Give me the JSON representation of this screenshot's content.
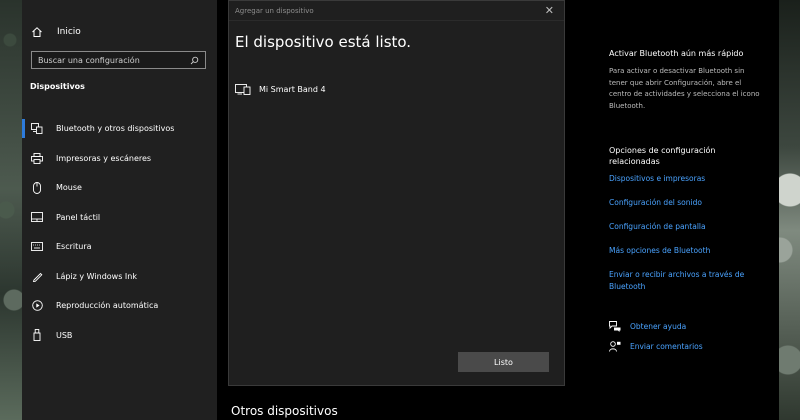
{
  "sidebar": {
    "home_label": "Inicio",
    "search_placeholder": "Buscar una configuración",
    "section_title": "Dispositivos",
    "items": [
      {
        "label": "Bluetooth y otros dispositivos",
        "icon": "bluetooth-devices-icon",
        "active": true
      },
      {
        "label": "Impresoras y escáneres",
        "icon": "printer-icon"
      },
      {
        "label": "Mouse",
        "icon": "mouse-icon"
      },
      {
        "label": "Panel táctil",
        "icon": "touchpad-icon"
      },
      {
        "label": "Escritura",
        "icon": "keyboard-icon"
      },
      {
        "label": "Lápiz y Windows Ink",
        "icon": "pen-icon"
      },
      {
        "label": "Reproducción automática",
        "icon": "autoplay-icon"
      },
      {
        "label": "USB",
        "icon": "usb-icon"
      }
    ]
  },
  "main": {
    "section_heading": "Otros dispositivos"
  },
  "dialog": {
    "title": "Agregar un dispositivo",
    "heading": "El dispositivo está listo.",
    "device_name": "Mi Smart Band 4",
    "done_label": "Listo"
  },
  "right_pane": {
    "bt_title": "Activar Bluetooth aún más rápido",
    "bt_desc": "Para activar o desactivar Bluetooth sin tener que abrir Configuración, abre el centro de actividades y selecciona el icono Bluetooth.",
    "related_title": "Opciones de configuración relacionadas",
    "links": [
      "Dispositivos e impresoras",
      "Configuración del sonido",
      "Configuración de pantalla",
      "Más opciones de Bluetooth",
      "Enviar o recibir archivos a través de Bluetooth"
    ],
    "help_label": "Obtener ayuda",
    "feedback_label": "Enviar comentarios"
  },
  "colors": {
    "accent": "#2d7bdc",
    "link": "#4aa3ff",
    "sidebar_bg": "#202020",
    "dialog_bg": "#1f1f1f",
    "button_bg": "#4a4a4a"
  }
}
